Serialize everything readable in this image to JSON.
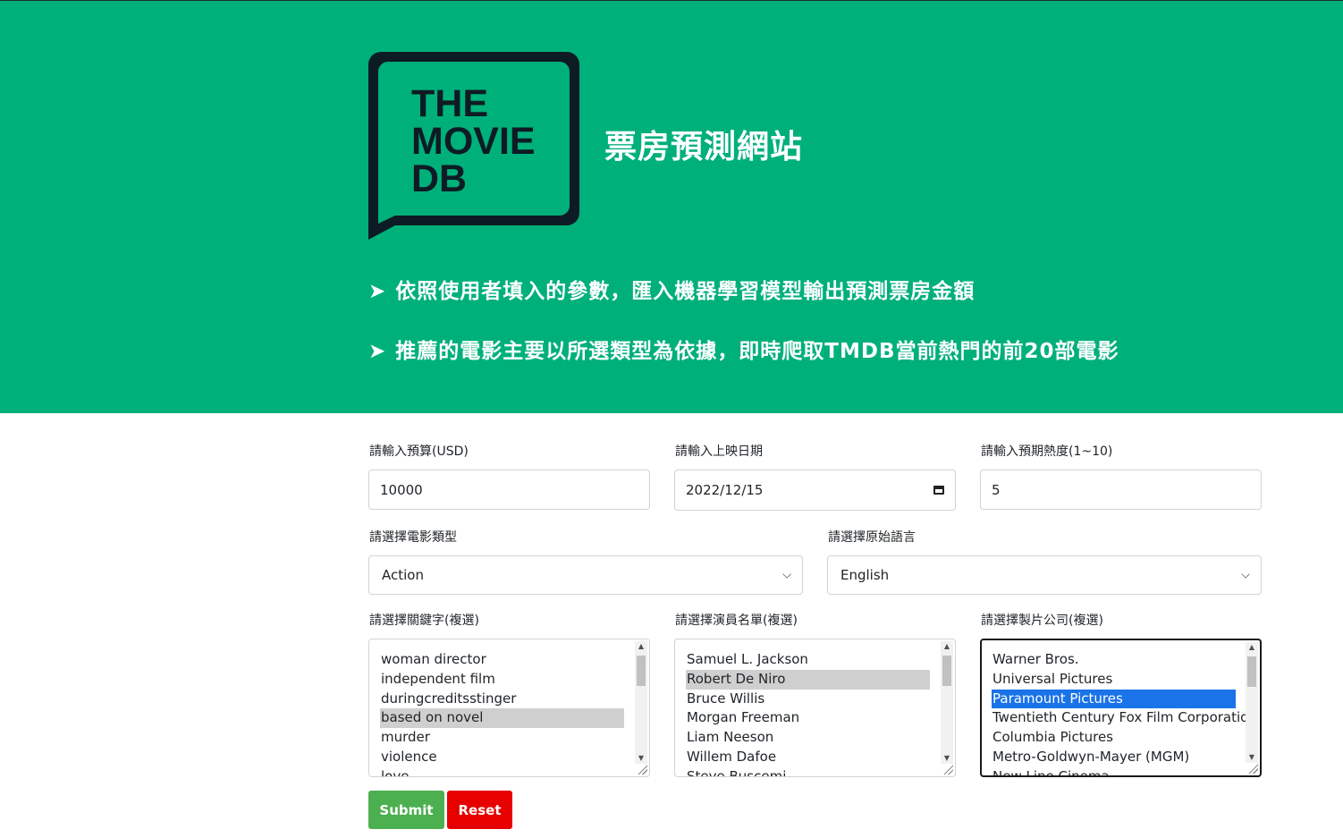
{
  "logo": {
    "lines": [
      "THE",
      "MOVIE",
      "DB"
    ]
  },
  "header": {
    "title": "票房預測網站",
    "arrow": "➤",
    "features": [
      "依照使用者填入的參數，匯入機器學習模型輸出預測票房金額",
      "推薦的電影主要以所選類型為依據，即時爬取TMDB當前熱門的前20部電影"
    ]
  },
  "form": {
    "budget": {
      "label": "請輸入預算(USD)",
      "value": "10000"
    },
    "release_date": {
      "label": "請輸入上映日期",
      "value": "2022/12/15"
    },
    "popularity": {
      "label": "請輸入預期熱度(1~10)",
      "value": "5"
    },
    "genre": {
      "label": "請選擇電影類型",
      "value": "Action"
    },
    "language": {
      "label": "請選擇原始語言",
      "value": "English"
    },
    "keywords": {
      "label": "請選擇關鍵字(複選)",
      "options": [
        "woman director",
        "independent film",
        "duringcreditsstinger",
        "based on novel",
        "murder",
        "violence",
        "love"
      ],
      "selected_index": 3
    },
    "cast": {
      "label": "請選擇演員名單(複選)",
      "options": [
        "Samuel L. Jackson",
        "Robert De Niro",
        "Bruce Willis",
        "Morgan Freeman",
        "Liam Neeson",
        "Willem Dafoe",
        "Steve Buscemi"
      ],
      "selected_index": 1
    },
    "companies": {
      "label": "請選擇製片公司(複選)",
      "options": [
        "Warner Bros.",
        "Universal Pictures",
        "Paramount Pictures",
        "Twentieth Century Fox Film Corporation",
        "Columbia Pictures",
        "Metro-Goldwyn-Mayer (MGM)",
        "New Line Cinema"
      ],
      "selected_index": 2
    }
  },
  "buttons": {
    "submit": "Submit",
    "reset": "Reset"
  },
  "colors": {
    "hero_bg": "#00b07a",
    "logo_dark": "#0d1b24",
    "submit_bg": "#4caf50",
    "reset_bg": "#e60000",
    "selected_blue": "#1a73e8"
  }
}
